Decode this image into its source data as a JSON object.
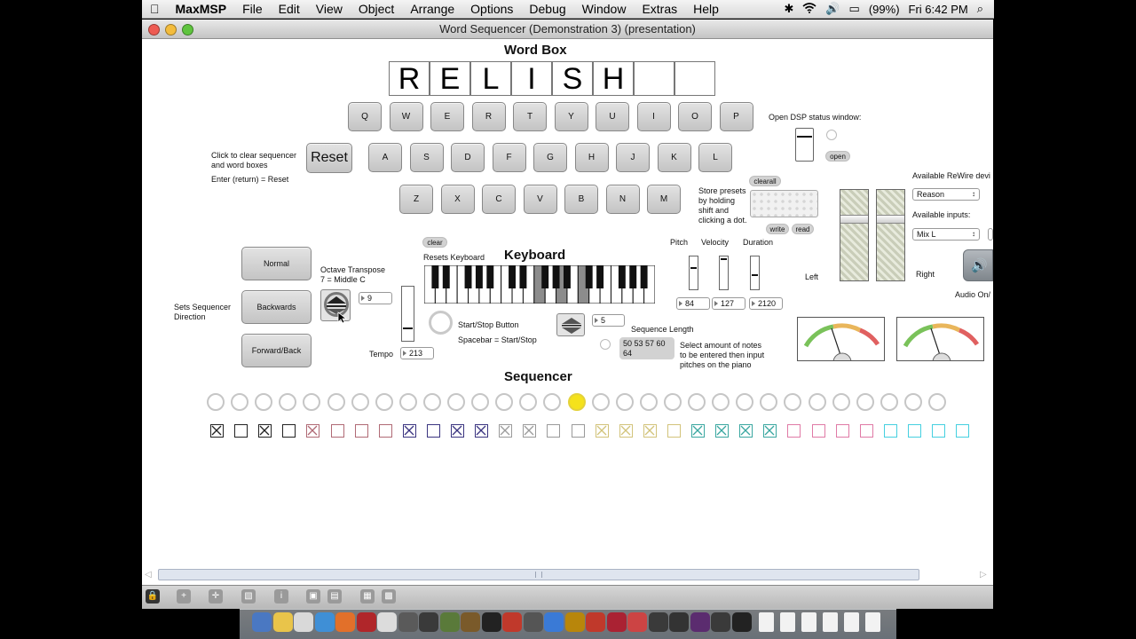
{
  "menubar": {
    "app": "MaxMSP",
    "items": [
      "File",
      "Edit",
      "View",
      "Object",
      "Arrange",
      "Options",
      "Debug",
      "Window",
      "Extras",
      "Help"
    ],
    "battery": "(99%)",
    "clock": "Fri 6:42 PM"
  },
  "window": {
    "title": "Word Sequencer (Demonstration 3) (presentation)"
  },
  "word_box": {
    "heading": "Word Box",
    "letters": [
      "R",
      "E",
      "L",
      "I",
      "S",
      "H",
      "",
      ""
    ]
  },
  "keyboard_keys": {
    "row1": [
      "Q",
      "W",
      "E",
      "R",
      "T",
      "Y",
      "U",
      "I",
      "O",
      "P"
    ],
    "row2": [
      "A",
      "S",
      "D",
      "F",
      "G",
      "H",
      "J",
      "K",
      "L"
    ],
    "row3": [
      "Z",
      "X",
      "C",
      "V",
      "B",
      "N",
      "M"
    ]
  },
  "reset": {
    "label": "Reset",
    "help1": "Click to clear sequencer",
    "help2": "and word boxes",
    "help3": "Enter (return) = Reset"
  },
  "dsp": {
    "status_label": "Open DSP status window:",
    "open_button": "open"
  },
  "presets": {
    "clearall": "clearall",
    "help": [
      "Store presets",
      "by holding",
      "shift and",
      "clicking a dot."
    ],
    "write": "write",
    "read": "read"
  },
  "rewire": {
    "label": "Available ReWire devi",
    "device": "Reason",
    "inputs_label": "Available inputs:",
    "input": "Mix L",
    "left": "Left",
    "right": "Right",
    "audio_label": "Audio On/"
  },
  "direction": {
    "label1": "Sets Sequencer",
    "label2": "Direction",
    "normal": "Normal",
    "backwards": "Backwards",
    "forwardback": "Forward/Back"
  },
  "octave": {
    "label1": "Octave Transpose",
    "label2": "7 = Middle C",
    "value": "9"
  },
  "tempo": {
    "label": "Tempo",
    "value": "213"
  },
  "piano": {
    "heading": "Keyboard",
    "clear": "clear",
    "resets": "Resets Keyboard"
  },
  "startstop": {
    "label": "Start/Stop Button",
    "hint": "Spacebar = Start/Stop"
  },
  "seq_length": {
    "label": "Sequence Length",
    "value": "5",
    "notes_line1": "50 53 57 60",
    "notes_line2": "64",
    "help": [
      "Select amount of notes",
      "to be entered then input",
      "pitches on the piano"
    ]
  },
  "params": {
    "pitch_label": "Pitch",
    "velocity_label": "Velocity",
    "duration_label": "Duration",
    "pitch": "84",
    "velocity": "127",
    "duration": "2120"
  },
  "sequencer": {
    "heading": "Sequencer",
    "step_count": 31,
    "active_step": 15,
    "active_color": "#f5e21b",
    "toggles": [
      {
        "color": "#222222",
        "checked": true
      },
      {
        "color": "#222222",
        "checked": false
      },
      {
        "color": "#222222",
        "checked": true
      },
      {
        "color": "#222222",
        "checked": false
      },
      {
        "color": "#b06a75",
        "checked": true
      },
      {
        "color": "#b06a75",
        "checked": false
      },
      {
        "color": "#b06a75",
        "checked": false
      },
      {
        "color": "#b06a75",
        "checked": false
      },
      {
        "color": "#3a3480",
        "checked": true
      },
      {
        "color": "#3a3480",
        "checked": false
      },
      {
        "color": "#3a3480",
        "checked": true
      },
      {
        "color": "#3a3480",
        "checked": true
      },
      {
        "color": "#9a9a9a",
        "checked": true
      },
      {
        "color": "#9a9a9a",
        "checked": true
      },
      {
        "color": "#9a9a9a",
        "checked": false
      },
      {
        "color": "#9a9a9a",
        "checked": false
      },
      {
        "color": "#d2c37a",
        "checked": true
      },
      {
        "color": "#d2c37a",
        "checked": true
      },
      {
        "color": "#d2c37a",
        "checked": true
      },
      {
        "color": "#d2c37a",
        "checked": false
      },
      {
        "color": "#3aa7a0",
        "checked": true
      },
      {
        "color": "#3aa7a0",
        "checked": true
      },
      {
        "color": "#3aa7a0",
        "checked": true
      },
      {
        "color": "#3aa7a0",
        "checked": true
      },
      {
        "color": "#e07aa6",
        "checked": false
      },
      {
        "color": "#e07aa6",
        "checked": false
      },
      {
        "color": "#e07aa6",
        "checked": false
      },
      {
        "color": "#e07aa6",
        "checked": false
      },
      {
        "color": "#45d0e0",
        "checked": false
      },
      {
        "color": "#45d0e0",
        "checked": false
      },
      {
        "color": "#45d0e0",
        "checked": false
      },
      {
        "color": "#45d0e0",
        "checked": false
      }
    ]
  }
}
